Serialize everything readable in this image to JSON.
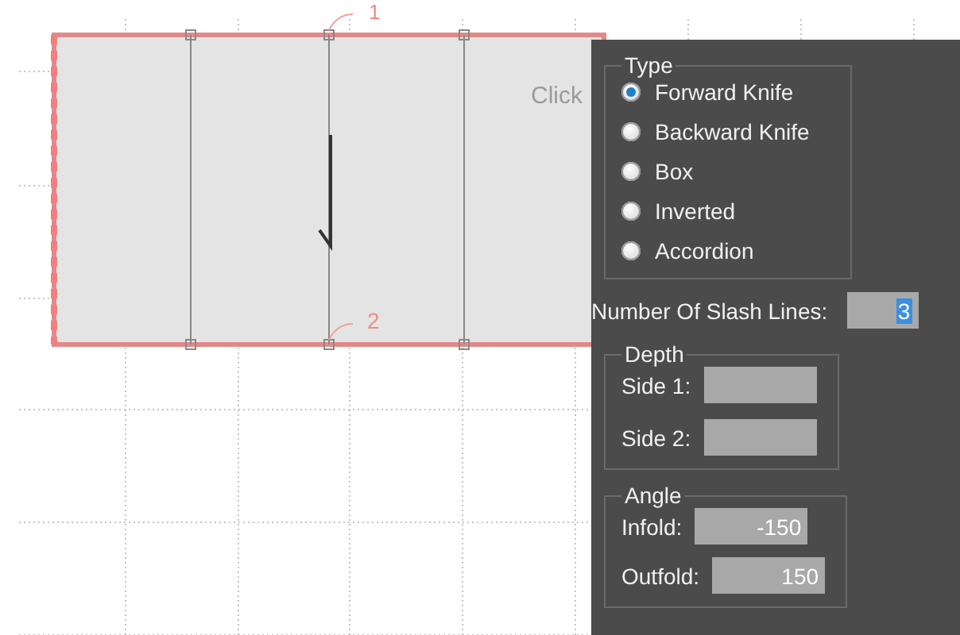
{
  "canvas": {
    "hint": "Click",
    "point_labels": [
      "1",
      "2"
    ]
  },
  "panel": {
    "type_group": {
      "title": "Type",
      "options": [
        {
          "label": "Forward Knife",
          "selected": true
        },
        {
          "label": "Backward Knife",
          "selected": false
        },
        {
          "label": "Box",
          "selected": false
        },
        {
          "label": "Inverted",
          "selected": false
        },
        {
          "label": "Accordion",
          "selected": false
        }
      ]
    },
    "slash_lines": {
      "label": "Number Of Slash Lines:",
      "value": "3"
    },
    "depth_group": {
      "title": "Depth",
      "fields": [
        {
          "label": "Side 1:"
        },
        {
          "label": "Side 2:"
        }
      ]
    },
    "angle_group": {
      "title": "Angle",
      "fields": [
        {
          "label": "Infold:",
          "value": "-150"
        },
        {
          "label": "Outfold:",
          "value": "150"
        }
      ]
    }
  }
}
